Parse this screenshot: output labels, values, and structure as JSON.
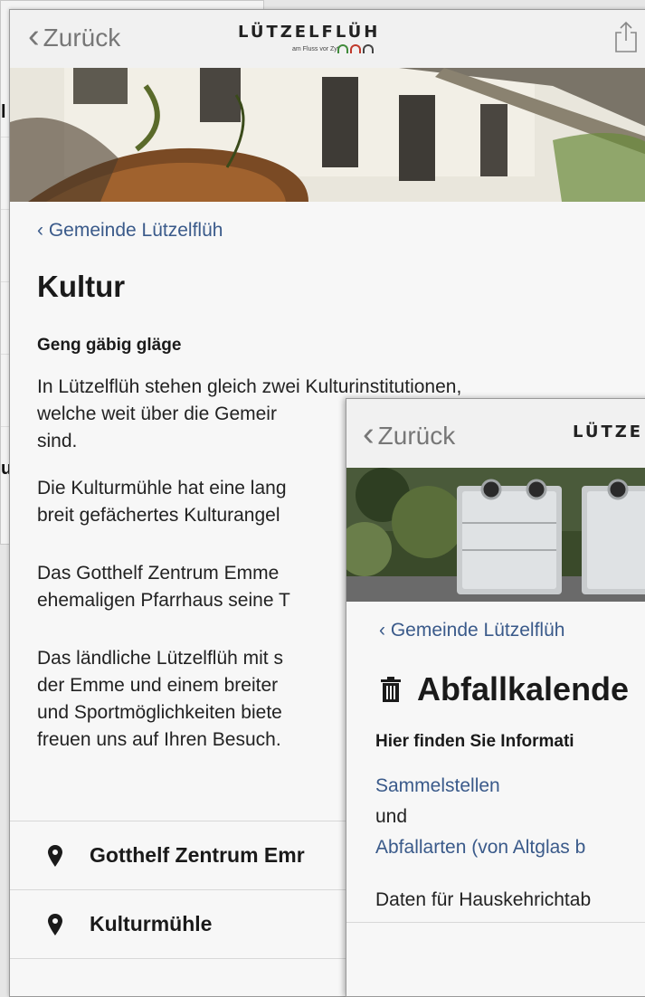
{
  "colors": {
    "link": "#3a5a8a",
    "arc_green": "#3f8a3a",
    "arc_red": "#c0392b",
    "arc_gray": "#444444"
  },
  "screen1": {
    "nav": {
      "back_label": "Zurück",
      "logo_name": "LÜTZELFLÜH",
      "logo_tagline": "am Fluss vor Zyt",
      "share_icon": "share-icon"
    },
    "breadcrumb": "Gemeinde Lützelflüh",
    "title": "Kultur",
    "subtitle": "Geng gäbig gläge",
    "paragraphs": [
      [
        "In Lützelflüh stehen gleich zwei Kulturinstitutionen,",
        "welche weit über die Gemeir",
        "sind."
      ],
      [
        "Die Kulturmühle hat eine lang",
        "breit gefächertes Kulturangel"
      ],
      [
        "Das Gotthelf Zentrum Emme",
        "ehemaligen Pfarrhaus seine T"
      ],
      [
        "Das ländliche Lützelflüh mit s",
        "der Emme und einem breiter",
        "und Sportmöglichkeiten biete",
        "freuen uns auf Ihren Besuch."
      ]
    ],
    "list": [
      {
        "label": "Gotthelf Zentrum Emr",
        "icon": "map-pin-icon"
      },
      {
        "label": "Kulturmühle",
        "icon": "map-pin-icon"
      }
    ]
  },
  "screen2": {
    "nav": {
      "back_label": "Zurück",
      "logo_name": "LÜTZE"
    },
    "breadcrumb": "Gemeinde Lützelflüh",
    "title": "Abfallkalende",
    "title_icon": "trash-icon",
    "subtitle": "Hier finden Sie Informati",
    "link1": "Sammelstellen",
    "and_text": "und",
    "link2": "Abfallarten (von Altglas b",
    "info": "Daten für Hauskehrichtab"
  },
  "background_screen": {
    "fragment_left": "l",
    "fragment_bottom": "u"
  }
}
